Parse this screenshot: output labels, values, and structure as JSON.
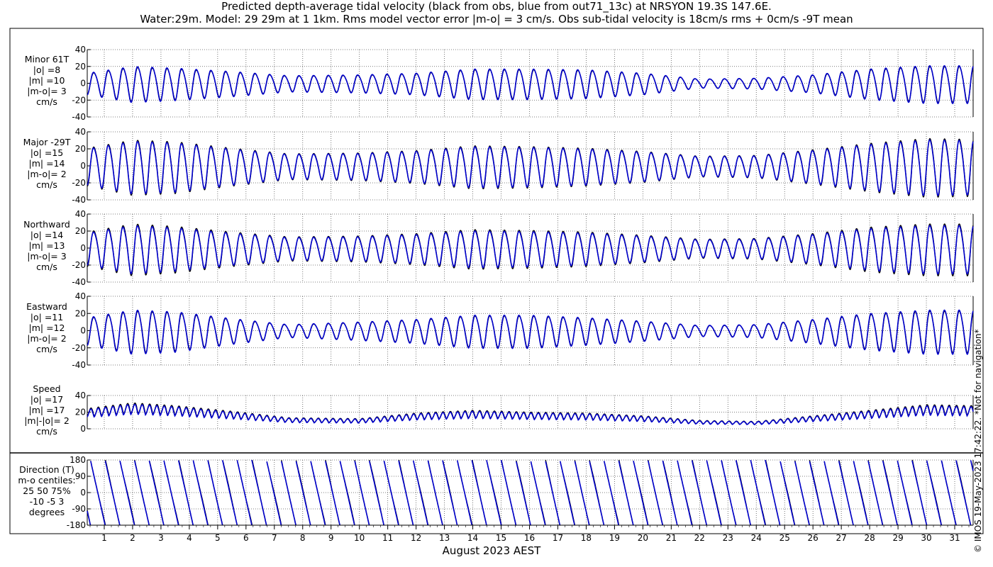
{
  "title_line1": "Predicted depth-average tidal velocity (black from obs, blue from out71_13c) at NRSYON 19.3S 147.6E.",
  "title_line2": "Water:29m. Model: 29 29m at 1 1km. Rms model vector error |m-o| = 3 cm/s. Obs sub-tidal velocity is 18cm/s rms + 0cm/s -9T mean",
  "xlabel": "August 2023 AEST",
  "stamp": "© IMOS 19-May-2023 17:42:22.  *Not for navigation*",
  "colors": {
    "obs": "#000000",
    "model": "#0000cc",
    "grid": "#555555"
  },
  "chart_data": {
    "type": "line",
    "x_days": [
      "1",
      "2",
      "3",
      "4",
      "5",
      "6",
      "7",
      "8",
      "9",
      "10",
      "11",
      "12",
      "13",
      "14",
      "15",
      "16",
      "17",
      "18",
      "19",
      "20",
      "21",
      "22",
      "23",
      "24",
      "25",
      "26",
      "27",
      "28",
      "29",
      "30",
      "31"
    ],
    "xlim": [
      0.4,
      31.65
    ],
    "series_names": [
      "obs",
      "model"
    ],
    "panels": [
      {
        "id": "minor",
        "label_lines": [
          "Minor 61T",
          "|o| =8",
          "|m| =10",
          "|m-o|= 3",
          "cm/s"
        ],
        "ylim": [
          -40,
          40
        ],
        "ticks": [
          "-40",
          "-20",
          "0",
          "20",
          "40"
        ],
        "kind": "tidal",
        "amp_envelope": [
          [
            0.4,
            12
          ],
          [
            2.0,
            20
          ],
          [
            3.5,
            18
          ],
          [
            5.5,
            14
          ],
          [
            7.5,
            9
          ],
          [
            10,
            10
          ],
          [
            12,
            12
          ],
          [
            14,
            17
          ],
          [
            16,
            17
          ],
          [
            18,
            16
          ],
          [
            20,
            12
          ],
          [
            22,
            5
          ],
          [
            24,
            6
          ],
          [
            26,
            10
          ],
          [
            28,
            17
          ],
          [
            30,
            21
          ],
          [
            31.65,
            21
          ]
        ],
        "mean": 0,
        "model_scale": 1.05
      },
      {
        "id": "major",
        "label_lines": [
          "Major -29T",
          "|o| =15",
          "|m| =14",
          "|m-o|= 2",
          "cm/s"
        ],
        "ylim": [
          -40,
          40
        ],
        "ticks": [
          "-40",
          "-20",
          "0",
          "20",
          "40"
        ],
        "kind": "tidal",
        "amp_envelope": [
          [
            0.4,
            22
          ],
          [
            2.0,
            32
          ],
          [
            3.5,
            30
          ],
          [
            5.5,
            22
          ],
          [
            7.5,
            15
          ],
          [
            10,
            16
          ],
          [
            12,
            19
          ],
          [
            14,
            25
          ],
          [
            16,
            24
          ],
          [
            18,
            22
          ],
          [
            20,
            18
          ],
          [
            22,
            12
          ],
          [
            24,
            13
          ],
          [
            26,
            20
          ],
          [
            28,
            28
          ],
          [
            30,
            34
          ],
          [
            31.65,
            33
          ]
        ],
        "mean": 0,
        "model_scale": 0.95
      },
      {
        "id": "northward",
        "label_lines": [
          "Northward",
          "|o| =14",
          "|m| =13",
          "|m-o|= 3",
          "cm/s"
        ],
        "ylim": [
          -40,
          40
        ],
        "ticks": [
          "-40",
          "-20",
          "0",
          "20",
          "40"
        ],
        "kind": "tidal",
        "amp_envelope": [
          [
            0.4,
            20
          ],
          [
            2.0,
            30
          ],
          [
            3.5,
            27
          ],
          [
            5.5,
            20
          ],
          [
            7.5,
            14
          ],
          [
            10,
            15
          ],
          [
            12,
            18
          ],
          [
            14,
            23
          ],
          [
            16,
            22
          ],
          [
            18,
            20
          ],
          [
            20,
            16
          ],
          [
            22,
            11
          ],
          [
            24,
            12
          ],
          [
            26,
            18
          ],
          [
            28,
            26
          ],
          [
            30,
            30
          ],
          [
            31.65,
            30
          ]
        ],
        "mean": 0,
        "model_scale": 0.93
      },
      {
        "id": "eastward",
        "label_lines": [
          "Eastward",
          "|o| =11",
          "|m| =12",
          "|m-o|= 2",
          "cm/s"
        ],
        "ylim": [
          -40,
          40
        ],
        "ticks": [
          "-40",
          "-20",
          "0",
          "20",
          "40"
        ],
        "kind": "tidal",
        "amp_envelope": [
          [
            0.4,
            15
          ],
          [
            2.0,
            24
          ],
          [
            3.5,
            22
          ],
          [
            5.5,
            14
          ],
          [
            7.5,
            7
          ],
          [
            10,
            10
          ],
          [
            12,
            13
          ],
          [
            14,
            18
          ],
          [
            16,
            18
          ],
          [
            18,
            15
          ],
          [
            20,
            11
          ],
          [
            22,
            6
          ],
          [
            24,
            7
          ],
          [
            26,
            13
          ],
          [
            28,
            20
          ],
          [
            30,
            24
          ],
          [
            31.65,
            24
          ]
        ],
        "mean": 0,
        "model_scale": 1.05
      },
      {
        "id": "speed",
        "label_lines": [
          "Speed",
          "|o| =17",
          "|m| =17",
          "|m|-|o|= 2",
          "cm/s"
        ],
        "ylim": [
          0,
          40
        ],
        "ticks": [
          "0",
          "20",
          "40"
        ],
        "kind": "speed",
        "amp_envelope": [
          [
            0.4,
            22
          ],
          [
            2.0,
            28
          ],
          [
            3.5,
            25
          ],
          [
            5.5,
            19
          ],
          [
            7.5,
            12
          ],
          [
            10,
            11
          ],
          [
            12,
            17
          ],
          [
            14,
            20
          ],
          [
            16,
            18
          ],
          [
            18,
            17
          ],
          [
            20,
            14
          ],
          [
            22,
            9
          ],
          [
            24,
            8
          ],
          [
            26,
            14
          ],
          [
            28,
            20
          ],
          [
            30,
            26
          ],
          [
            31.65,
            25
          ]
        ],
        "mean": 0,
        "model_scale": 0.95
      },
      {
        "id": "direction",
        "label_lines": [
          "Direction (T)",
          "m-o centiles:",
          "25  50  75%",
          "-10  -5   3",
          "degrees"
        ],
        "ylim": [
          -180,
          180
        ],
        "ticks": [
          "-180",
          "-90",
          "0",
          "90",
          "180"
        ],
        "kind": "direction",
        "mean": 0,
        "model_scale": 1
      }
    ]
  }
}
